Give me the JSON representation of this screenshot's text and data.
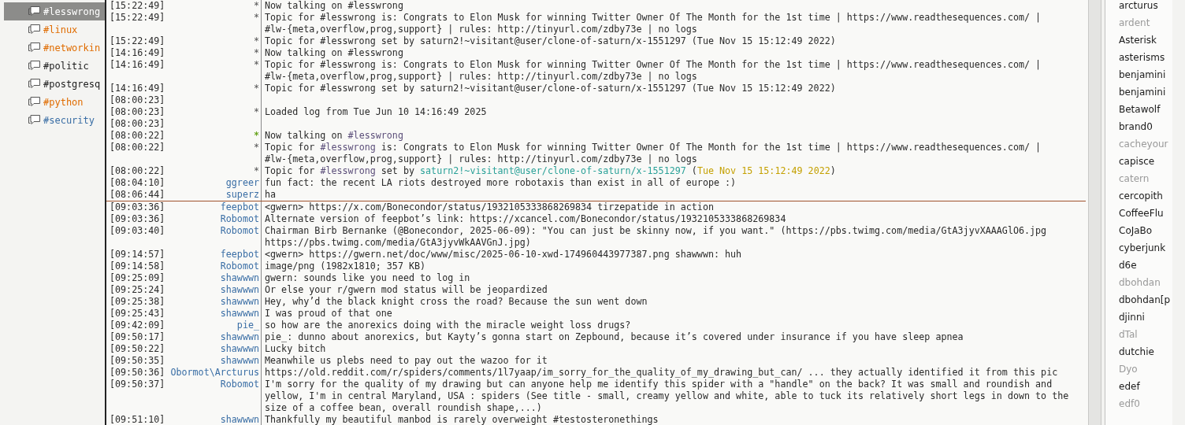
{
  "channels": [
    {
      "label": "#lesswrong",
      "selected": true,
      "color": "#ffffff"
    },
    {
      "label": "#linux",
      "selected": false,
      "color": "#e06c00"
    },
    {
      "label": "#networkin",
      "selected": false,
      "color": "#e06c00"
    },
    {
      "label": "#politic",
      "selected": false,
      "color": "#202020"
    },
    {
      "label": "#postgresq",
      "selected": false,
      "color": "#202020"
    },
    {
      "label": "#python",
      "selected": false,
      "color": "#e06c00"
    },
    {
      "label": "#security",
      "selected": false,
      "color": "#3a6ea5"
    }
  ],
  "chat": [
    {
      "kind": "message",
      "time": "[15:22:49]",
      "nick": "*",
      "parts": [
        {
          "text": "Now talking on #lesswrong"
        }
      ]
    },
    {
      "kind": "message",
      "time": "[15:22:49]",
      "nick": "*",
      "parts": [
        {
          "text": "Topic for #lesswrong is: Congrats to Elon Musk for winning Twitter Owner Of The Month for the 1st time | https://www.readthesequences.com/ |\n#lw-{meta,overflow,prog,support} | rules: http://tinyurl.com/zdby73e | no logs"
        }
      ]
    },
    {
      "kind": "message",
      "time": "[15:22:49]",
      "nick": "*",
      "parts": [
        {
          "text": "Topic for #lesswrong set by saturn2!~visitant@user/clone-of-saturn/x-1551297 (Tue Nov 15 15:12:49 2022)"
        }
      ]
    },
    {
      "kind": "message",
      "time": "[14:16:49]",
      "nick": "*",
      "parts": [
        {
          "text": "Now talking on #lesswrong"
        }
      ]
    },
    {
      "kind": "message",
      "time": "[14:16:49]",
      "nick": "*",
      "parts": [
        {
          "text": "Topic for #lesswrong is: Congrats to Elon Musk for winning Twitter Owner Of The Month for the 1st time | https://www.readthesequences.com/ |\n#lw-{meta,overflow,prog,support} | rules: http://tinyurl.com/zdby73e | no logs"
        }
      ]
    },
    {
      "kind": "message",
      "time": "[14:16:49]",
      "nick": "*",
      "parts": [
        {
          "text": "Topic for #lesswrong set by saturn2!~visitant@user/clone-of-saturn/x-1551297 (Tue Nov 15 15:12:49 2022)"
        }
      ]
    },
    {
      "kind": "message",
      "time": "[08:00:23]"
    },
    {
      "kind": "message",
      "time": "[08:00:23]",
      "nick": "*",
      "parts": [
        {
          "text": "Loaded log from Tue Jun 10 14:16:49 2025"
        }
      ]
    },
    {
      "kind": "message",
      "time": "[08:00:23]"
    },
    {
      "kind": "message",
      "time": "[08:00:22]",
      "nick": "*",
      "color": "#6aa521",
      "parts": [
        {
          "text": "Now talking on "
        },
        {
          "text": "#lesswrong",
          "color": "#5c4f7a"
        }
      ]
    },
    {
      "kind": "message",
      "time": "[08:00:22]",
      "nick": "*",
      "parts": [
        {
          "text": "Topic for "
        },
        {
          "text": "#lesswrong",
          "color": "#5c4f7a"
        },
        {
          "text": " is: Congrats to Elon Musk for winning Twitter Owner Of The Month for the 1st time | https://www.readthesequences.com/ |\n#lw-{meta,overflow,prog,support} | rules: http://tinyurl.com/zdby73e | no logs"
        }
      ]
    },
    {
      "kind": "message",
      "time": "[08:00:22]",
      "nick": "*",
      "parts": [
        {
          "text": "Topic for "
        },
        {
          "text": "#lesswrong",
          "color": "#5c4f7a"
        },
        {
          "text": " set by "
        },
        {
          "text": "saturn2!~visitant@user/clone-of-saturn/x-1551297",
          "color": "#2aa198"
        },
        {
          "text": " ("
        },
        {
          "text": "Tue Nov 15 15:12:49 2022",
          "color": "#c4a000"
        },
        {
          "text": ")"
        }
      ]
    },
    {
      "kind": "message",
      "time": "[08:04:10]",
      "nick": "ggreer",
      "parts": [
        {
          "text": "fun fact: the recent LA riots destroyed more robotaxis than exist in all of europe :)"
        }
      ]
    },
    {
      "kind": "message",
      "time": "[08:06:44]",
      "nick": "superz",
      "parts": [
        {
          "text": "ha"
        }
      ]
    },
    {
      "kind": "marker"
    },
    {
      "kind": "message",
      "time": "[09:03:36]",
      "nick": "feepbot",
      "parts": [
        {
          "text": "<gwern> https://x.com/Bonecondor/status/1932105333868269834 tirzepatide in action"
        }
      ]
    },
    {
      "kind": "message",
      "time": "[09:03:36]",
      "nick": "Robomot",
      "parts": [
        {
          "text": "Alternate version of feepbot’s link: https://xcancel.com/Bonecondor/status/1932105333868269834"
        }
      ]
    },
    {
      "kind": "message",
      "time": "[09:03:40]",
      "nick": "Robomot",
      "parts": [
        {
          "text": "Chairman Birb Bernanke (@Bonecondor, 2025-06-09): \"You can just be skinny now, if you want.\" (https://pbs.twimg.com/media/GtA3jyvXAAAGlO6.jpg\nhttps://pbs.twimg.com/media/GtA3jyvWkAAVGnJ.jpg)"
        }
      ]
    },
    {
      "kind": "message",
      "time": "[09:14:57]",
      "nick": "feepbot",
      "parts": [
        {
          "text": "<gwern> https://gwern.net/doc/www/misc/2025-06-10-xwd-174960443977387.png shawwwn: huh"
        }
      ]
    },
    {
      "kind": "message",
      "time": "[09:14:58]",
      "nick": "Robomot",
      "parts": [
        {
          "text": "image/png (1982x1810; 357 KB)"
        }
      ]
    },
    {
      "kind": "message",
      "time": "[09:25:09]",
      "nick": "shawwwn",
      "parts": [
        {
          "text": "gwern: sounds like you need to log in"
        }
      ]
    },
    {
      "kind": "message",
      "time": "[09:25:24]",
      "nick": "shawwwn",
      "parts": [
        {
          "text": "Or else your r/gwern mod status will be jeopardized"
        }
      ]
    },
    {
      "kind": "message",
      "time": "[09:25:38]",
      "nick": "shawwwn",
      "parts": [
        {
          "text": "Hey, why’d the black knight cross the road? Because the sun went down"
        }
      ]
    },
    {
      "kind": "message",
      "time": "[09:25:43]",
      "nick": "shawwwn",
      "parts": [
        {
          "text": "I was proud of that one"
        }
      ]
    },
    {
      "kind": "message",
      "time": "[09:42:09]",
      "nick": "pie_",
      "parts": [
        {
          "text": "so how are the anorexics doing with the miracle weight loss drugs?"
        }
      ]
    },
    {
      "kind": "message",
      "time": "[09:50:17]",
      "nick": "shawwwn",
      "parts": [
        {
          "text": "pie_: dunno about anorexics, but Kayty’s gonna start on Zepbound, because it’s covered under insurance if you have sleep apnea"
        }
      ]
    },
    {
      "kind": "message",
      "time": "[09:50:22]",
      "nick": "shawwwn",
      "parts": [
        {
          "text": "Lucky bitch"
        }
      ]
    },
    {
      "kind": "message",
      "time": "[09:50:35]",
      "nick": "shawwwn",
      "parts": [
        {
          "text": "Meanwhile us plebs need to pay out the wazoo for it"
        }
      ]
    },
    {
      "kind": "message",
      "time": "[09:50:36]",
      "nick": "Obormot\\Arcturus",
      "parts": [
        {
          "text": "https://old.reddit.com/r/spiders/comments/1l7yaap/im_sorry_for_the_quality_of_my_drawing_but_can/ ... they actually identified it from this pic"
        }
      ]
    },
    {
      "kind": "message",
      "time": "[09:50:37]",
      "nick": "Robomot",
      "parts": [
        {
          "text": "I'm sorry for the quality of my drawing but can anyone help me identify this spider with a \"handle\" on the back? It was small and roundish and\nyellow, I'm in central Maryland, USA : spiders (See title - small, creamy yellow and white, able to tuck its relatively short legs in down to the\nsize of a coffee bean, overall roundish shape,...)"
        }
      ]
    },
    {
      "kind": "message",
      "time": "[09:51:10]",
      "nick": "shawwwn",
      "parts": [
        {
          "text": "Thankfully my beautiful manbod is rarely overweight #testosteronethings"
        }
      ]
    }
  ],
  "users": [
    {
      "name": "arcturus",
      "away": false
    },
    {
      "name": "ardent",
      "away": true
    },
    {
      "name": "Asterisk",
      "away": false
    },
    {
      "name": "asterisms",
      "away": false
    },
    {
      "name": "benjamini",
      "away": false
    },
    {
      "name": "benjamini",
      "away": false
    },
    {
      "name": "Betawolf",
      "away": false
    },
    {
      "name": "brand0",
      "away": false
    },
    {
      "name": "cacheyour",
      "away": true
    },
    {
      "name": "capisce",
      "away": false
    },
    {
      "name": "catern",
      "away": true
    },
    {
      "name": "cercopith",
      "away": false
    },
    {
      "name": "CoffeeFlu",
      "away": false
    },
    {
      "name": "CoJaBo",
      "away": false
    },
    {
      "name": "cyberjunk",
      "away": false
    },
    {
      "name": "d6e",
      "away": false
    },
    {
      "name": "dbohdan",
      "away": true
    },
    {
      "name": "dbohdan[p",
      "away": false
    },
    {
      "name": "djinni",
      "away": false
    },
    {
      "name": "dTal",
      "away": true
    },
    {
      "name": "dutchie",
      "away": false
    },
    {
      "name": "Dyo",
      "away": true
    },
    {
      "name": "edef",
      "away": false
    },
    {
      "name": "edf0",
      "away": true
    }
  ]
}
